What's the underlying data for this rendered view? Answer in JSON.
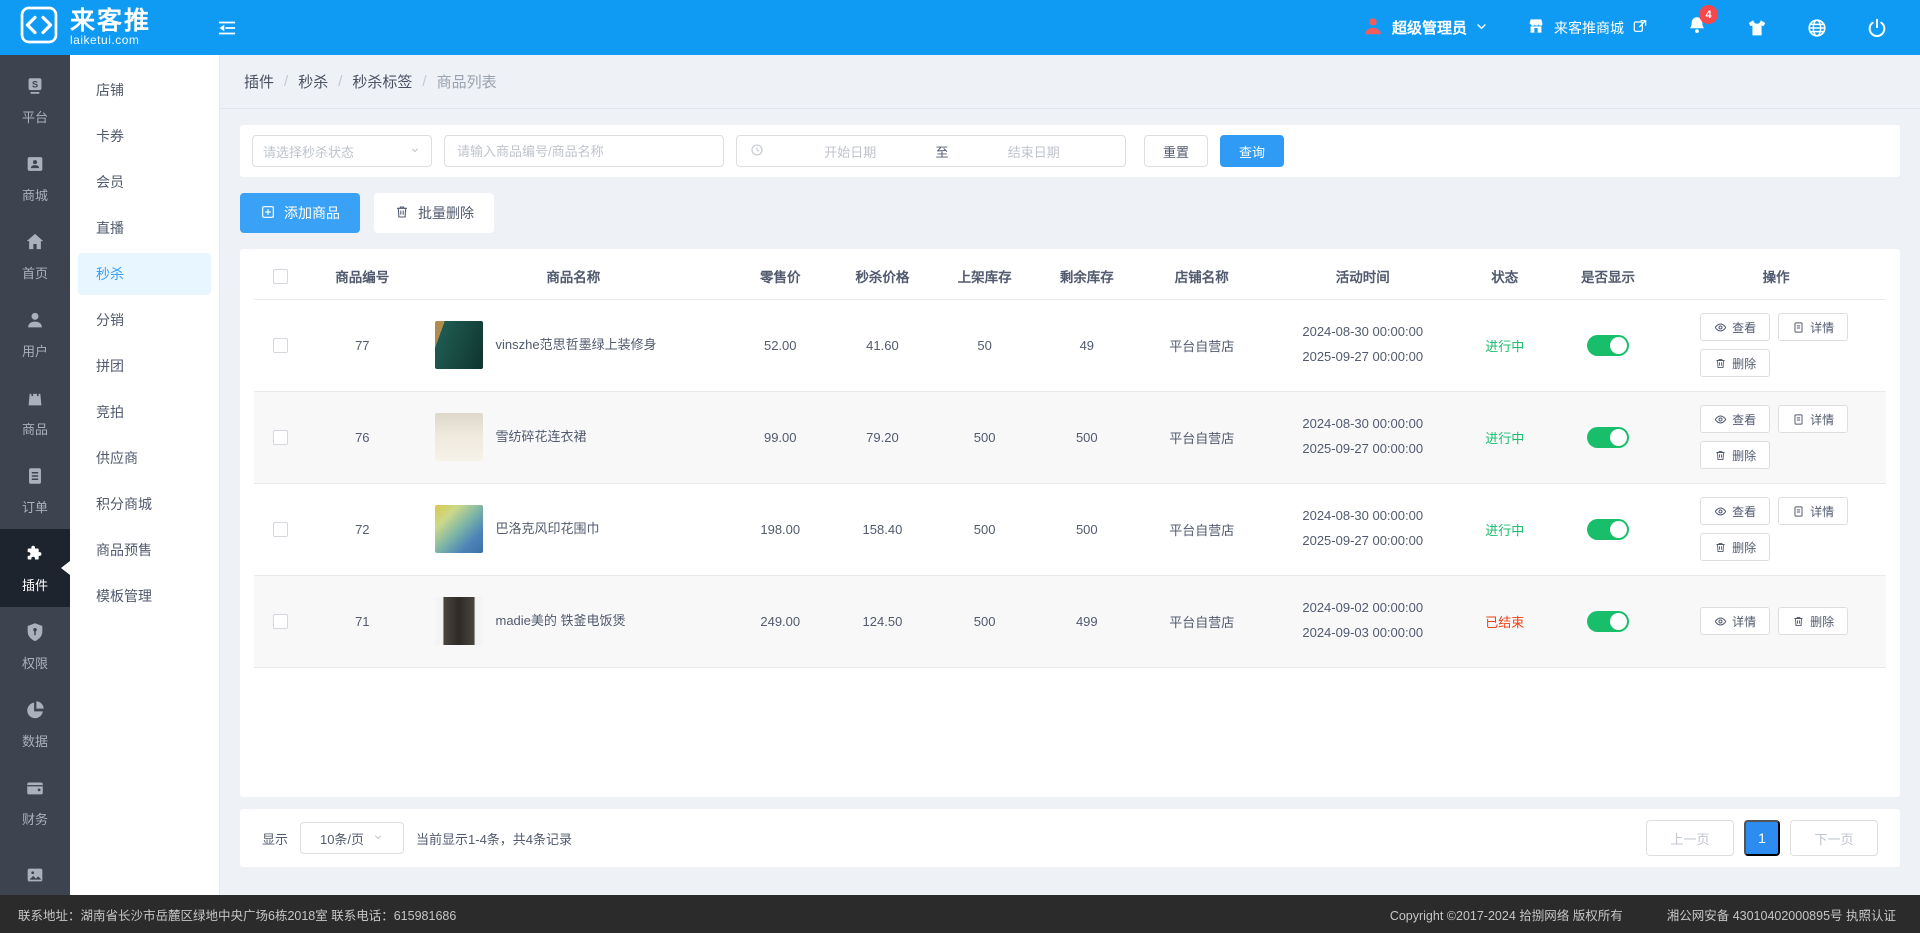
{
  "header": {
    "logo_title": "来客推",
    "logo_subtitle": "laiketui.com",
    "user_role": "超级管理员",
    "mall_link_label": "来客推商城",
    "notification_count": "4"
  },
  "colors": {
    "primary": "#2f9bf5",
    "header_bg": "#0f9bf3",
    "success": "#19be6b",
    "danger": "#ed4014",
    "sidebar_bg": "#3d4450",
    "footer_bg": "#2b2b2b"
  },
  "primary_nav": {
    "items": [
      {
        "label": "平台",
        "icon": "platform-s-icon"
      },
      {
        "label": "商城",
        "icon": "mall-card-icon"
      },
      {
        "label": "首页",
        "icon": "home-icon"
      },
      {
        "label": "用户",
        "icon": "user-icon"
      },
      {
        "label": "商品",
        "icon": "goods-bag-icon"
      },
      {
        "label": "订单",
        "icon": "order-clipboard-icon"
      },
      {
        "label": "插件",
        "icon": "plugin-puzzle-icon",
        "active": true
      },
      {
        "label": "权限",
        "icon": "permission-shield-icon"
      },
      {
        "label": "数据",
        "icon": "data-pie-icon"
      },
      {
        "label": "财务",
        "icon": "finance-wallet-icon"
      },
      {
        "label": "",
        "icon": "media-photo-icon"
      }
    ]
  },
  "secondary_nav": {
    "active": "秒杀",
    "items": [
      {
        "label": "店铺"
      },
      {
        "label": "卡券"
      },
      {
        "label": "会员"
      },
      {
        "label": "直播"
      },
      {
        "label": "秒杀"
      },
      {
        "label": "分销"
      },
      {
        "label": "拼团"
      },
      {
        "label": "竞拍"
      },
      {
        "label": "供应商"
      },
      {
        "label": "积分商城"
      },
      {
        "label": "商品预售"
      },
      {
        "label": "模板管理"
      }
    ]
  },
  "breadcrumb": {
    "items": [
      "插件",
      "秒杀",
      "秒杀标签",
      "商品列表"
    ],
    "separator": "/"
  },
  "filters": {
    "status_select_placeholder": "请选择秒杀状态",
    "search_placeholder": "请输入商品编号/商品名称",
    "date_start_placeholder": "开始日期",
    "date_separator": "至",
    "date_end_placeholder": "结束日期",
    "reset_label": "重置",
    "query_label": "查询"
  },
  "toolbar": {
    "add_label": "添加商品",
    "batch_delete_label": "批量删除"
  },
  "table": {
    "columns": [
      "商品编号",
      "商品名称",
      "零售价",
      "秒杀价格",
      "上架库存",
      "剩余库存",
      "店铺名称",
      "活动时间",
      "状态",
      "是否显示",
      "操作"
    ],
    "rows": [
      {
        "id": "77",
        "name": "vinszhe范思哲墨绿上装修身",
        "retail_price": "52.00",
        "seckill_price": "41.60",
        "stock": "50",
        "remaining": "49",
        "store": "平台自营店",
        "time_start": "2024-08-30 00:00:00",
        "time_end": "2025-09-27 00:00:00",
        "status": "进行中",
        "status_color": "#19be6b",
        "visible": true,
        "image_css": "linear-gradient(110deg,#b08d4f 0%,#b08d4f 15%,#1e5a50 15%,#17473f 60%,#0e332e 100%)",
        "actions": [
          {
            "label": "查看",
            "icon": "eye-icon"
          },
          {
            "label": "详情",
            "icon": "file-icon"
          },
          {
            "label": "删除",
            "icon": "trash-icon"
          }
        ]
      },
      {
        "id": "76",
        "name": "雪纺碎花连衣裙",
        "retail_price": "99.00",
        "seckill_price": "79.20",
        "stock": "500",
        "remaining": "500",
        "store": "平台自营店",
        "time_start": "2024-08-30 00:00:00",
        "time_end": "2025-09-27 00:00:00",
        "status": "进行中",
        "status_color": "#19be6b",
        "visible": true,
        "image_css": "linear-gradient(180deg,#ded8cc 0%,#efe9dd 45%,#f6f2e9 100%)",
        "actions": [
          {
            "label": "查看",
            "icon": "eye-icon"
          },
          {
            "label": "详情",
            "icon": "file-icon"
          },
          {
            "label": "删除",
            "icon": "trash-icon"
          }
        ]
      },
      {
        "id": "72",
        "name": "巴洛克风印花围巾",
        "retail_price": "198.00",
        "seckill_price": "158.40",
        "stock": "500",
        "remaining": "500",
        "store": "平台自营店",
        "time_start": "2024-08-30 00:00:00",
        "time_end": "2025-09-27 00:00:00",
        "status": "进行中",
        "status_color": "#19be6b",
        "visible": true,
        "image_css": "linear-gradient(135deg,#d9c84a 0%,#cbd98a 25%,#7fb6a6 50%,#4e86b8 75%,#3b6fa8 100%)",
        "actions": [
          {
            "label": "查看",
            "icon": "eye-icon"
          },
          {
            "label": "详情",
            "icon": "file-icon"
          },
          {
            "label": "删除",
            "icon": "trash-icon"
          }
        ]
      },
      {
        "id": "71",
        "name": "madie美的 铁釜电饭煲",
        "retail_price": "249.00",
        "seckill_price": "124.50",
        "stock": "500",
        "remaining": "499",
        "store": "平台自营店",
        "time_start": "2024-09-02 00:00:00",
        "time_end": "2024-09-03 00:00:00",
        "status": "已结束",
        "status_color": "#ed4014",
        "visible": true,
        "image_css": "linear-gradient(90deg,#f4f4f4 0%,#f4f4f4 16%,#4a443e 19%,#2e2a26 50%,#4a443e 81%,#f4f4f4 84%)",
        "actions": [
          {
            "label": "详情",
            "icon": "eye-icon"
          },
          {
            "label": "删除",
            "icon": "trash-icon"
          }
        ]
      }
    ]
  },
  "pagination": {
    "show_label": "显示",
    "page_size": "10条/页",
    "summary": "当前显示1-4条，共4条记录",
    "prev_label": "上一页",
    "current_page": "1",
    "next_label": "下一页"
  },
  "footer": {
    "contact": "联系地址：湖南省长沙市岳麓区绿地中央广场6栋2018室 联系电话：615981686",
    "copyright": "Copyright ©2017-2024 拾捌网络 版权所有",
    "record": "湘公网安备 43010402000895号 执照认证"
  }
}
